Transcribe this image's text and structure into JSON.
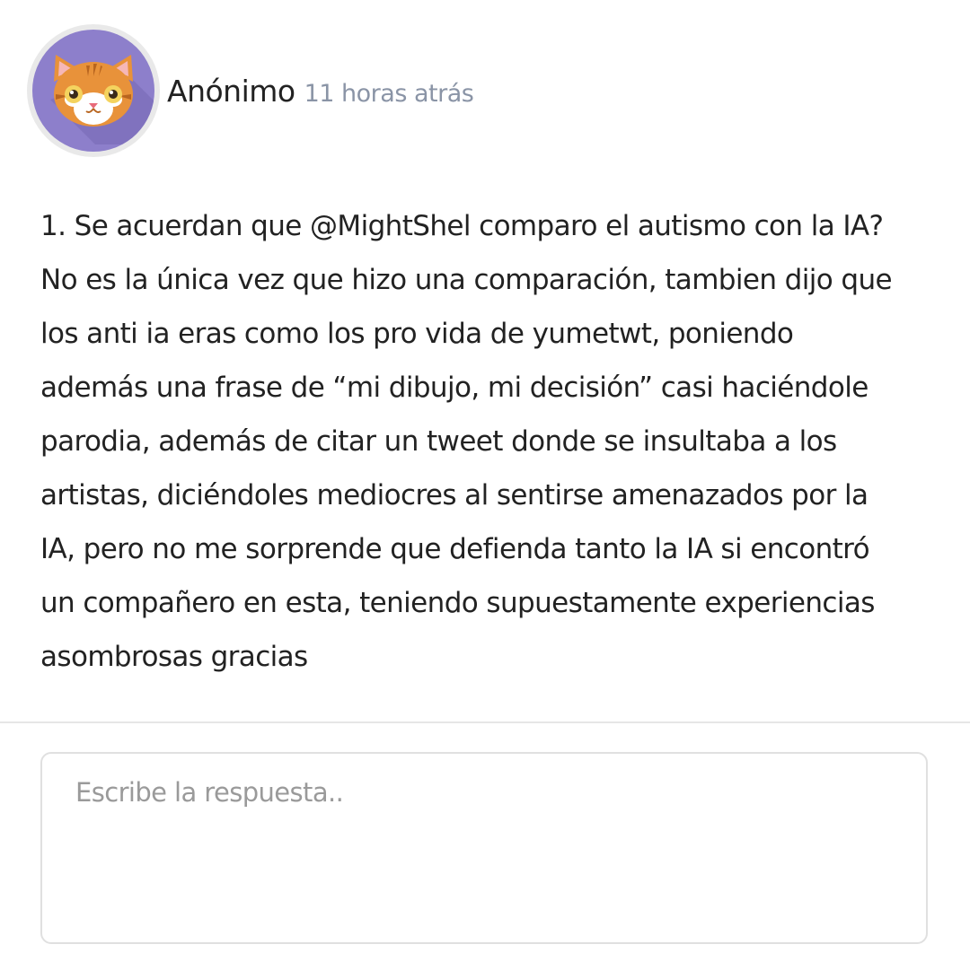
{
  "post": {
    "author": "Anónimo",
    "time": "11 horas atrás",
    "avatar_icon": "cat-face-icon",
    "body_lines": [
      "1. Se acuerdan que @MightShel comparo el autismo con la IA?",
      "No es la única vez que hizo una comparación, tambien dijo que",
      "los anti ia eras como los pro vida de yumetwt, poniendo",
      "además una frase de “mi dibujo, mi decisión” casi haciéndole",
      "parodia, además de citar un tweet donde se insultaba a los",
      "artistas, diciéndoles mediocres al sentirse amenazados por la",
      "IA, pero no me sorprende que defienda tanto la IA si encontró",
      "un compañero en esta, teniendo supuestamente experiencias",
      "asombrosas gracias"
    ]
  },
  "reply": {
    "placeholder": "Escribe la respuesta..",
    "value": ""
  },
  "colors": {
    "avatar_bg": "#8d7fcb",
    "time_text": "#8a94a6",
    "divider": "#e6e6e6"
  }
}
